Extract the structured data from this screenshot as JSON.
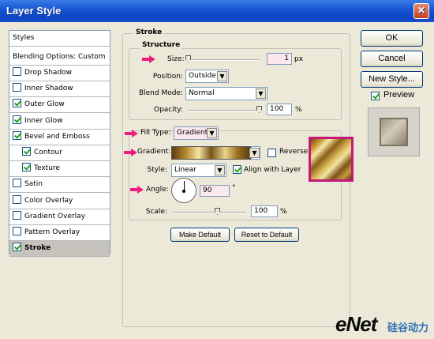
{
  "window": {
    "title": "Layer Style",
    "close_label": "✕"
  },
  "styles_panel": {
    "header": "Styles",
    "blending_options": "Blending Options: Custom",
    "items": [
      {
        "label": "Drop Shadow",
        "checked": false
      },
      {
        "label": "Inner Shadow",
        "checked": false
      },
      {
        "label": "Outer Glow",
        "checked": true
      },
      {
        "label": "Inner Glow",
        "checked": true
      },
      {
        "label": "Bevel and Emboss",
        "checked": true
      },
      {
        "label": "Contour",
        "checked": true
      },
      {
        "label": "Texture",
        "checked": true
      },
      {
        "label": "Satin",
        "checked": false
      },
      {
        "label": "Color Overlay",
        "checked": false
      },
      {
        "label": "Gradient Overlay",
        "checked": false
      },
      {
        "label": "Pattern Overlay",
        "checked": false
      },
      {
        "label": "Stroke",
        "checked": true,
        "selected": true
      }
    ]
  },
  "stroke": {
    "section_title": "Stroke",
    "structure_title": "Structure",
    "size_label": "Size:",
    "size_value": "1",
    "size_unit": "px",
    "position_label": "Position:",
    "position_value": "Outside",
    "blend_mode_label": "Blend Mode:",
    "blend_mode_value": "Normal",
    "opacity_label": "Opacity:",
    "opacity_value": "100",
    "opacity_unit": "%",
    "fill_type_label": "Fill Type:",
    "fill_type_value": "Gradient",
    "gradient_label": "Gradient:",
    "reverse_label": "Reverse",
    "reverse_checked": false,
    "style_label": "Style:",
    "style_value": "Linear",
    "align_label": "Align with Layer",
    "align_checked": true,
    "angle_label": "Angle:",
    "angle_value": "90",
    "angle_unit": "°",
    "scale_label": "Scale:",
    "scale_value": "100",
    "scale_unit": "%",
    "make_default": "Make Default",
    "reset_default": "Reset to Default"
  },
  "buttons": {
    "ok": "OK",
    "cancel": "Cancel",
    "new_style": "New Style...",
    "preview_label": "Preview",
    "preview_checked": true
  },
  "colors": {
    "accent_arrow": "#ee1c80",
    "swatch_border": "#c6167a"
  },
  "watermark": {
    "brand": "eNet",
    "cn": "硅谷动力"
  }
}
